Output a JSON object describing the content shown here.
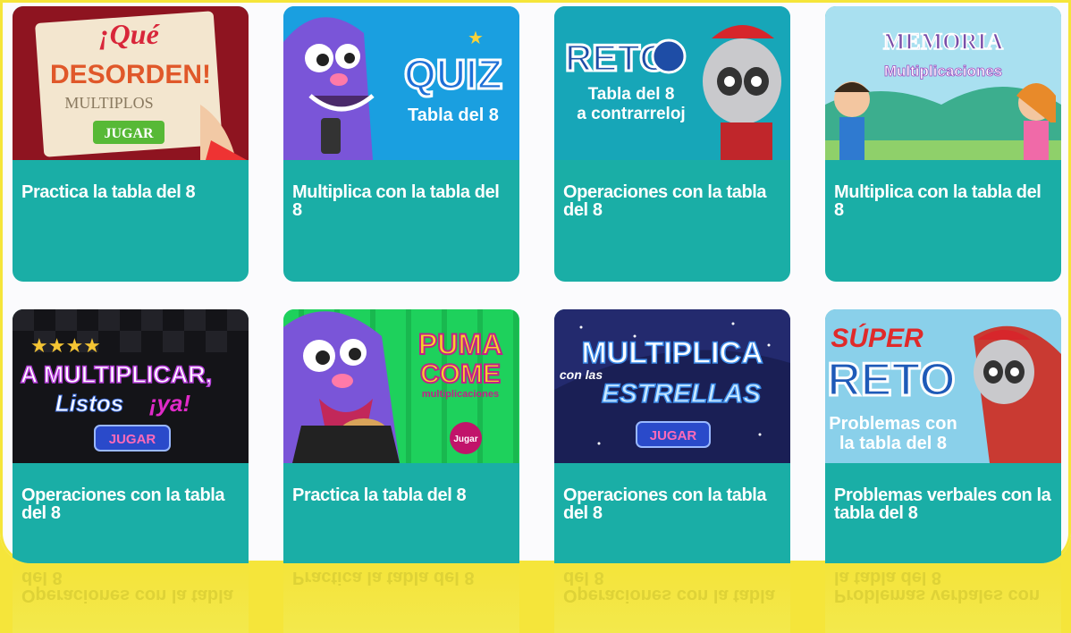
{
  "cards": [
    {
      "caption": "Practica la tabla del 8",
      "thumb": {
        "line1": "¡Qué",
        "line2": "DESORDEN!",
        "line3": "MULTIPLOS",
        "button": "JUGAR"
      }
    },
    {
      "caption": "Multiplica con la tabla del 8",
      "thumb": {
        "line1": "QUIZ",
        "line2": "Tabla del 8"
      }
    },
    {
      "caption": "Operaciones con la tabla del 8",
      "thumb": {
        "line1": "RETO",
        "line2": "Tabla del 8",
        "line3": "a contrarreloj"
      }
    },
    {
      "caption": "Multiplica con la tabla del 8",
      "thumb": {
        "line1": "MEMORIA",
        "line2": "Multiplicaciones"
      }
    },
    {
      "caption": "Operaciones con la tabla del 8",
      "thumb": {
        "line1": "A MULTIPLICAR,",
        "line2": "Listos",
        "line3": "¡ya!",
        "button": "JUGAR"
      }
    },
    {
      "caption": "Practica la tabla del 8",
      "thumb": {
        "line1": "PUMA",
        "line2": "COME",
        "line3": "multiplicaciones",
        "button": "Jugar"
      }
    },
    {
      "caption": "Operaciones con la tabla del 8",
      "thumb": {
        "line1": "MULTIPLICA",
        "line2": "con las",
        "line3": "ESTRELLAS",
        "button": "JUGAR"
      }
    },
    {
      "caption": "Problemas verbales con la tabla del 8",
      "thumb": {
        "line1": "SÚPER",
        "line2": "RETO",
        "line3": "Problemas con",
        "line4": "la tabla del 8"
      }
    }
  ],
  "reflection": [
    "Operaciones con la tabla del 8",
    "Practica la tabla del 8",
    "Operaciones con la tabla del 8",
    "Problemas verbales con la tabla del 8"
  ],
  "colors": {
    "card": "#1aaea6",
    "page_bg": "#f5e53a",
    "panel": "#fbfbfd"
  }
}
